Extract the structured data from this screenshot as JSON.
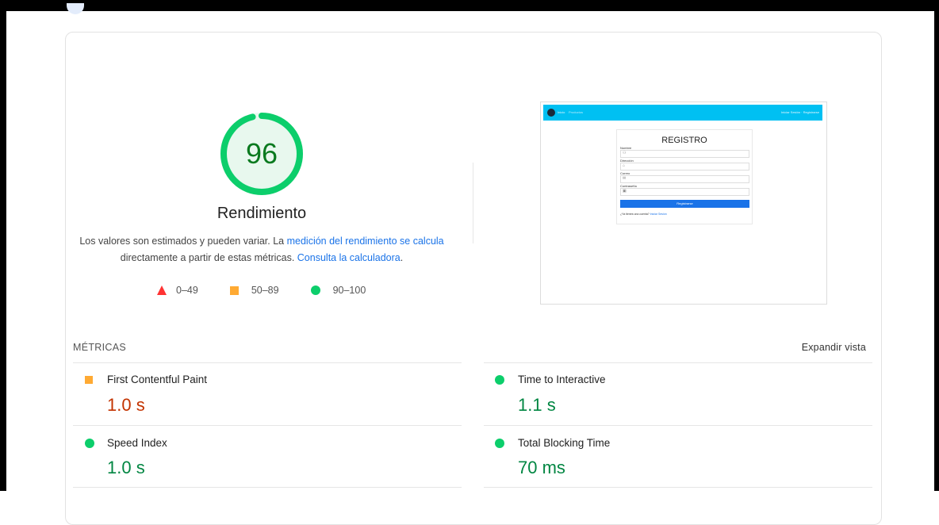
{
  "score": {
    "value": "96",
    "fraction": 0.96,
    "label": "Rendimiento",
    "color": "#0cce6b"
  },
  "description": {
    "text_1": "Los valores son estimados y pueden variar. La ",
    "link_1": "medición del rendimiento se calcula",
    "text_2": " directamente a partir de estas métricas. ",
    "link_2": "Consulta la calculadora",
    "text_3": "."
  },
  "legend": [
    {
      "icon": "fail-triangle-icon",
      "range": "0–49",
      "color": "#ff3333"
    },
    {
      "icon": "average-square-icon",
      "range": "50–89",
      "color": "#ffaa33"
    },
    {
      "icon": "pass-circle-icon",
      "range": "90–100",
      "color": "#0cce6b"
    }
  ],
  "screenshot": {
    "nav_brand": "Inicio",
    "nav_link": "Productos",
    "nav_right": "Iniciar Sesión · Registrarse",
    "title": "REGISTRO",
    "fields": [
      {
        "label": "Nombre",
        "icon": "user-icon"
      },
      {
        "label": "Dirección",
        "icon": "home-icon"
      },
      {
        "label": "Correo",
        "icon": "mail-icon"
      },
      {
        "label": "Contraseña",
        "icon": "lock-icon"
      }
    ],
    "button": "Registrarse",
    "footer_text": "¿Ya tienes una cuenta?",
    "footer_link": "Iniciar Sesión"
  },
  "metrics_section": {
    "heading": "MÉTRICAS",
    "expand_label": "Expandir vista"
  },
  "metrics": [
    {
      "name": "First Contentful Paint",
      "value": "1.0 s",
      "status": "average",
      "color": "#c33300"
    },
    {
      "name": "Time to Interactive",
      "value": "1.1 s",
      "status": "pass",
      "color": "#018642"
    },
    {
      "name": "Speed Index",
      "value": "1.0 s",
      "status": "pass",
      "color": "#018642"
    },
    {
      "name": "Total Blocking Time",
      "value": "70 ms",
      "status": "pass",
      "color": "#018642"
    }
  ]
}
